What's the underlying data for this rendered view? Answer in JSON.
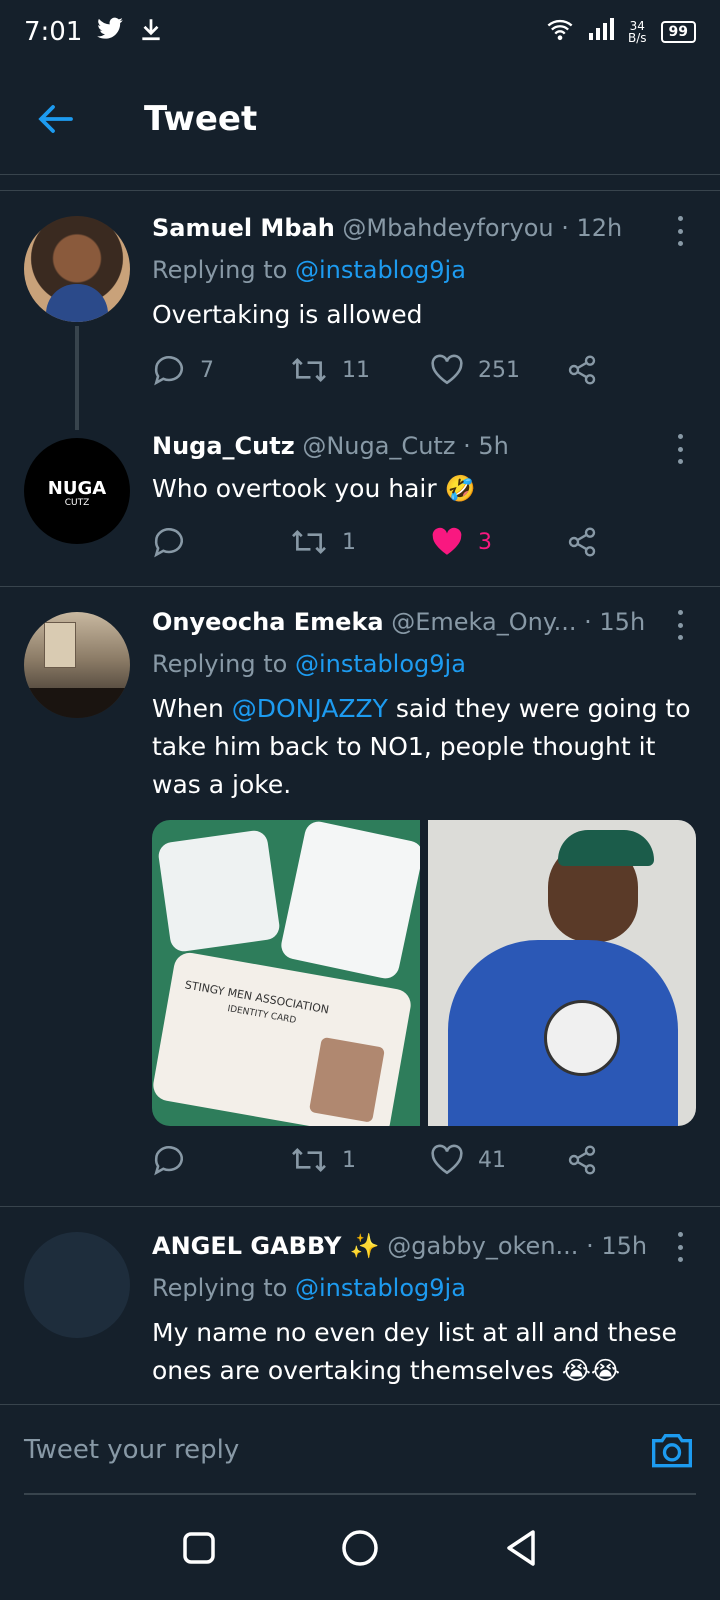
{
  "status": {
    "time": "7:01",
    "net_speed_top": "34",
    "net_speed_bottom": "B/s",
    "battery": "99"
  },
  "header": {
    "title": "Tweet"
  },
  "tweets": [
    {
      "name": "Samuel Mbah",
      "handle": "@Mbahdeyforyou",
      "time": "· 12h",
      "replying_prefix": "Replying to ",
      "replying_handle": "@instablog9ja",
      "text": "Overtaking is allowed",
      "replies": "7",
      "retweets": "11",
      "likes": "251"
    },
    {
      "name": "Nuga_Cutz",
      "handle": "@Nuga_Cutz",
      "time": "· 5h",
      "text": "Who overtook you hair 🤣",
      "replies": "",
      "retweets": "1",
      "likes": "3",
      "avatar_text": "NUGA",
      "avatar_sub": "CUTZ"
    },
    {
      "name": "Onyeocha Emeka",
      "handle": "@Emeka_Ony...",
      "time": "· 15h",
      "replying_prefix": "Replying to ",
      "replying_handle": "@instablog9ja",
      "text_before": "When ",
      "mention": "@DONJAZZY",
      "text_after": " said they were going to take him back to NO1, people thought it was a joke.",
      "media_left_card_title": "STINGY MEN ASSOCIATION",
      "media_left_card_sub": "IDENTITY CARD",
      "replies": "",
      "retweets": "1",
      "likes": "41"
    },
    {
      "name": "ANGEL GABBY ✨",
      "handle": "@gabby_oken...",
      "time": "· 15h",
      "replying_prefix": "Replying to ",
      "replying_handle": "@instablog9ja",
      "text": "My name no even dey list at all and these ones are overtaking themselves 😭😭"
    }
  ],
  "composer": {
    "placeholder": "Tweet your reply"
  },
  "colors": {
    "background": "#15202b",
    "accent": "#1d9bf0",
    "like": "#f91880",
    "muted": "#8899a6"
  }
}
